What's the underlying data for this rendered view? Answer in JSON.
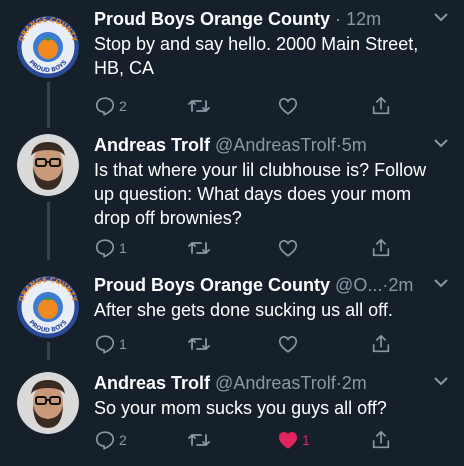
{
  "tweets": [
    {
      "name": "Proud Boys Orange County",
      "handle": "",
      "separator": "·",
      "time": "12m",
      "text": "Stop by and say hello. 2000 Main Street, HB, CA",
      "avatar": "orange-county-seal",
      "replies": "2",
      "retweets": "",
      "likes": "",
      "liked": false
    },
    {
      "name": "Andreas Trolf",
      "handle": "@AndreasTrolf",
      "separator": "·",
      "time": "5m",
      "text": "Is that where your lil clubhouse is? Follow up question: What days does your mom drop off brownies?",
      "avatar": "bearded-man-glasses",
      "replies": "1",
      "retweets": "",
      "likes": "",
      "liked": false
    },
    {
      "name": "Proud Boys Orange County",
      "handle": "@O...",
      "separator": "·",
      "time": "2m",
      "text": "After she gets done sucking us all off.",
      "avatar": "orange-county-seal",
      "replies": "1",
      "retweets": "",
      "likes": "",
      "liked": false
    },
    {
      "name": "Andreas Trolf",
      "handle": "@AndreasTrolf",
      "separator": "·",
      "time": "2m",
      "text": "So your mom sucks you guys all off?",
      "avatar": "bearded-man-glasses",
      "replies": "2",
      "retweets": "",
      "likes": "1",
      "liked": true
    }
  ],
  "logo": {
    "top_text": "ORANGE COUNTY",
    "bottom_text": "PROUD BOYS"
  },
  "colors": {
    "background": "#15202b",
    "text": "#ffffff",
    "secondary": "#8899a6",
    "thread_line": "#38444d",
    "like": "#e0245e",
    "logo_blue": "#2c4a9a",
    "logo_orange": "#f08a1e"
  },
  "icons": [
    "reply-icon",
    "retweet-icon",
    "like-icon",
    "share-icon",
    "chevron-down-icon"
  ]
}
